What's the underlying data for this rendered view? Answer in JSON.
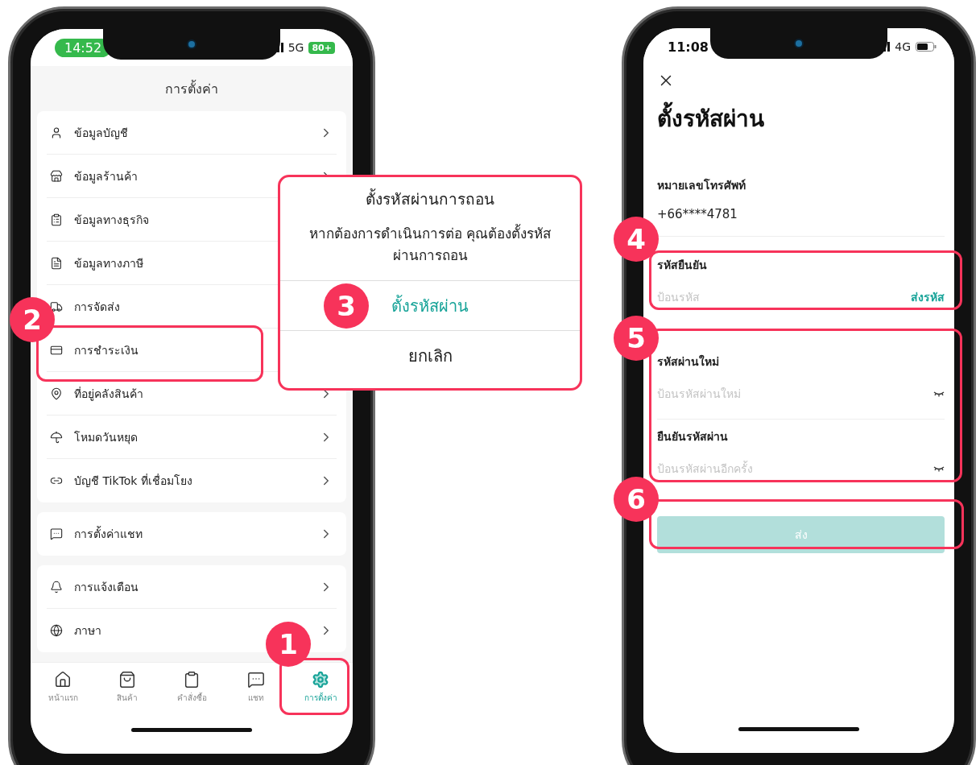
{
  "settings_screen": {
    "status_bar": {
      "time": "14:52",
      "network": "5G",
      "battery": "80+"
    },
    "title": "การตั้งค่า",
    "groups": [
      {
        "items": [
          {
            "label": "ข้อมูลบัญชี",
            "chevron": true
          },
          {
            "label": "ข้อมูลร้านค้า",
            "chevron": true
          },
          {
            "label": "ข้อมูลทางธุรกิจ"
          },
          {
            "label": "ข้อมูลทางภาษี"
          },
          {
            "label": "การจัดส่ง"
          },
          {
            "label": "การชำระเงิน",
            "step": "2"
          },
          {
            "label": "ที่อยู่คลังสินค้า",
            "chevron": true
          },
          {
            "label": "โหมดวันหยุด",
            "chevron": true
          },
          {
            "label": "บัญชี TikTok ที่เชื่อมโยง",
            "chevron": true
          }
        ]
      },
      {
        "items": [
          {
            "label": "การตั้งค่าแชท",
            "chevron": true
          }
        ]
      },
      {
        "items": [
          {
            "label": "การแจ้งเตือน",
            "chevron": true
          },
          {
            "label": "ภาษา",
            "chevron": true
          }
        ]
      }
    ],
    "tab_bar": [
      {
        "label": "หน้าแรก",
        "selected": false
      },
      {
        "label": "สินค้า",
        "selected": false
      },
      {
        "label": "คำสั่งซื้อ",
        "selected": false
      },
      {
        "label": "แชท",
        "selected": false
      },
      {
        "label": "การตั้งค่า",
        "selected": true,
        "step": "1"
      }
    ]
  },
  "dialog": {
    "title": "ตั้งรหัสผ่านการถอน",
    "message": "หากต้องการดำเนินการต่อ คุณต้องตั้งรหัสผ่านการถอน",
    "confirm": {
      "label": "ตั้งรหัสผ่าน",
      "step": "3"
    },
    "cancel": "ยกเลิก"
  },
  "password_screen": {
    "status_bar": {
      "time": "11:08",
      "network": "4G"
    },
    "title": "ตั้งรหัสผ่าน",
    "phone": {
      "label": "หมายเลขโทรศัพท์",
      "value": "+66****4781"
    },
    "verification": {
      "label": "รหัสยืนยัน",
      "placeholder": "ป้อนรหัส",
      "action": "ส่งรหัส",
      "step": "4"
    },
    "password_group": {
      "step": "5",
      "fields": [
        {
          "label": "รหัสผ่านใหม่",
          "placeholder": "ป้อนรหัสผ่านใหม่"
        },
        {
          "label": "ยืนยันรหัสผ่าน",
          "placeholder": "ป้อนรหัสผ่านอีกครั้ง"
        }
      ]
    },
    "submit": {
      "label": "ส่ง",
      "disabled": true,
      "step": "6"
    }
  }
}
